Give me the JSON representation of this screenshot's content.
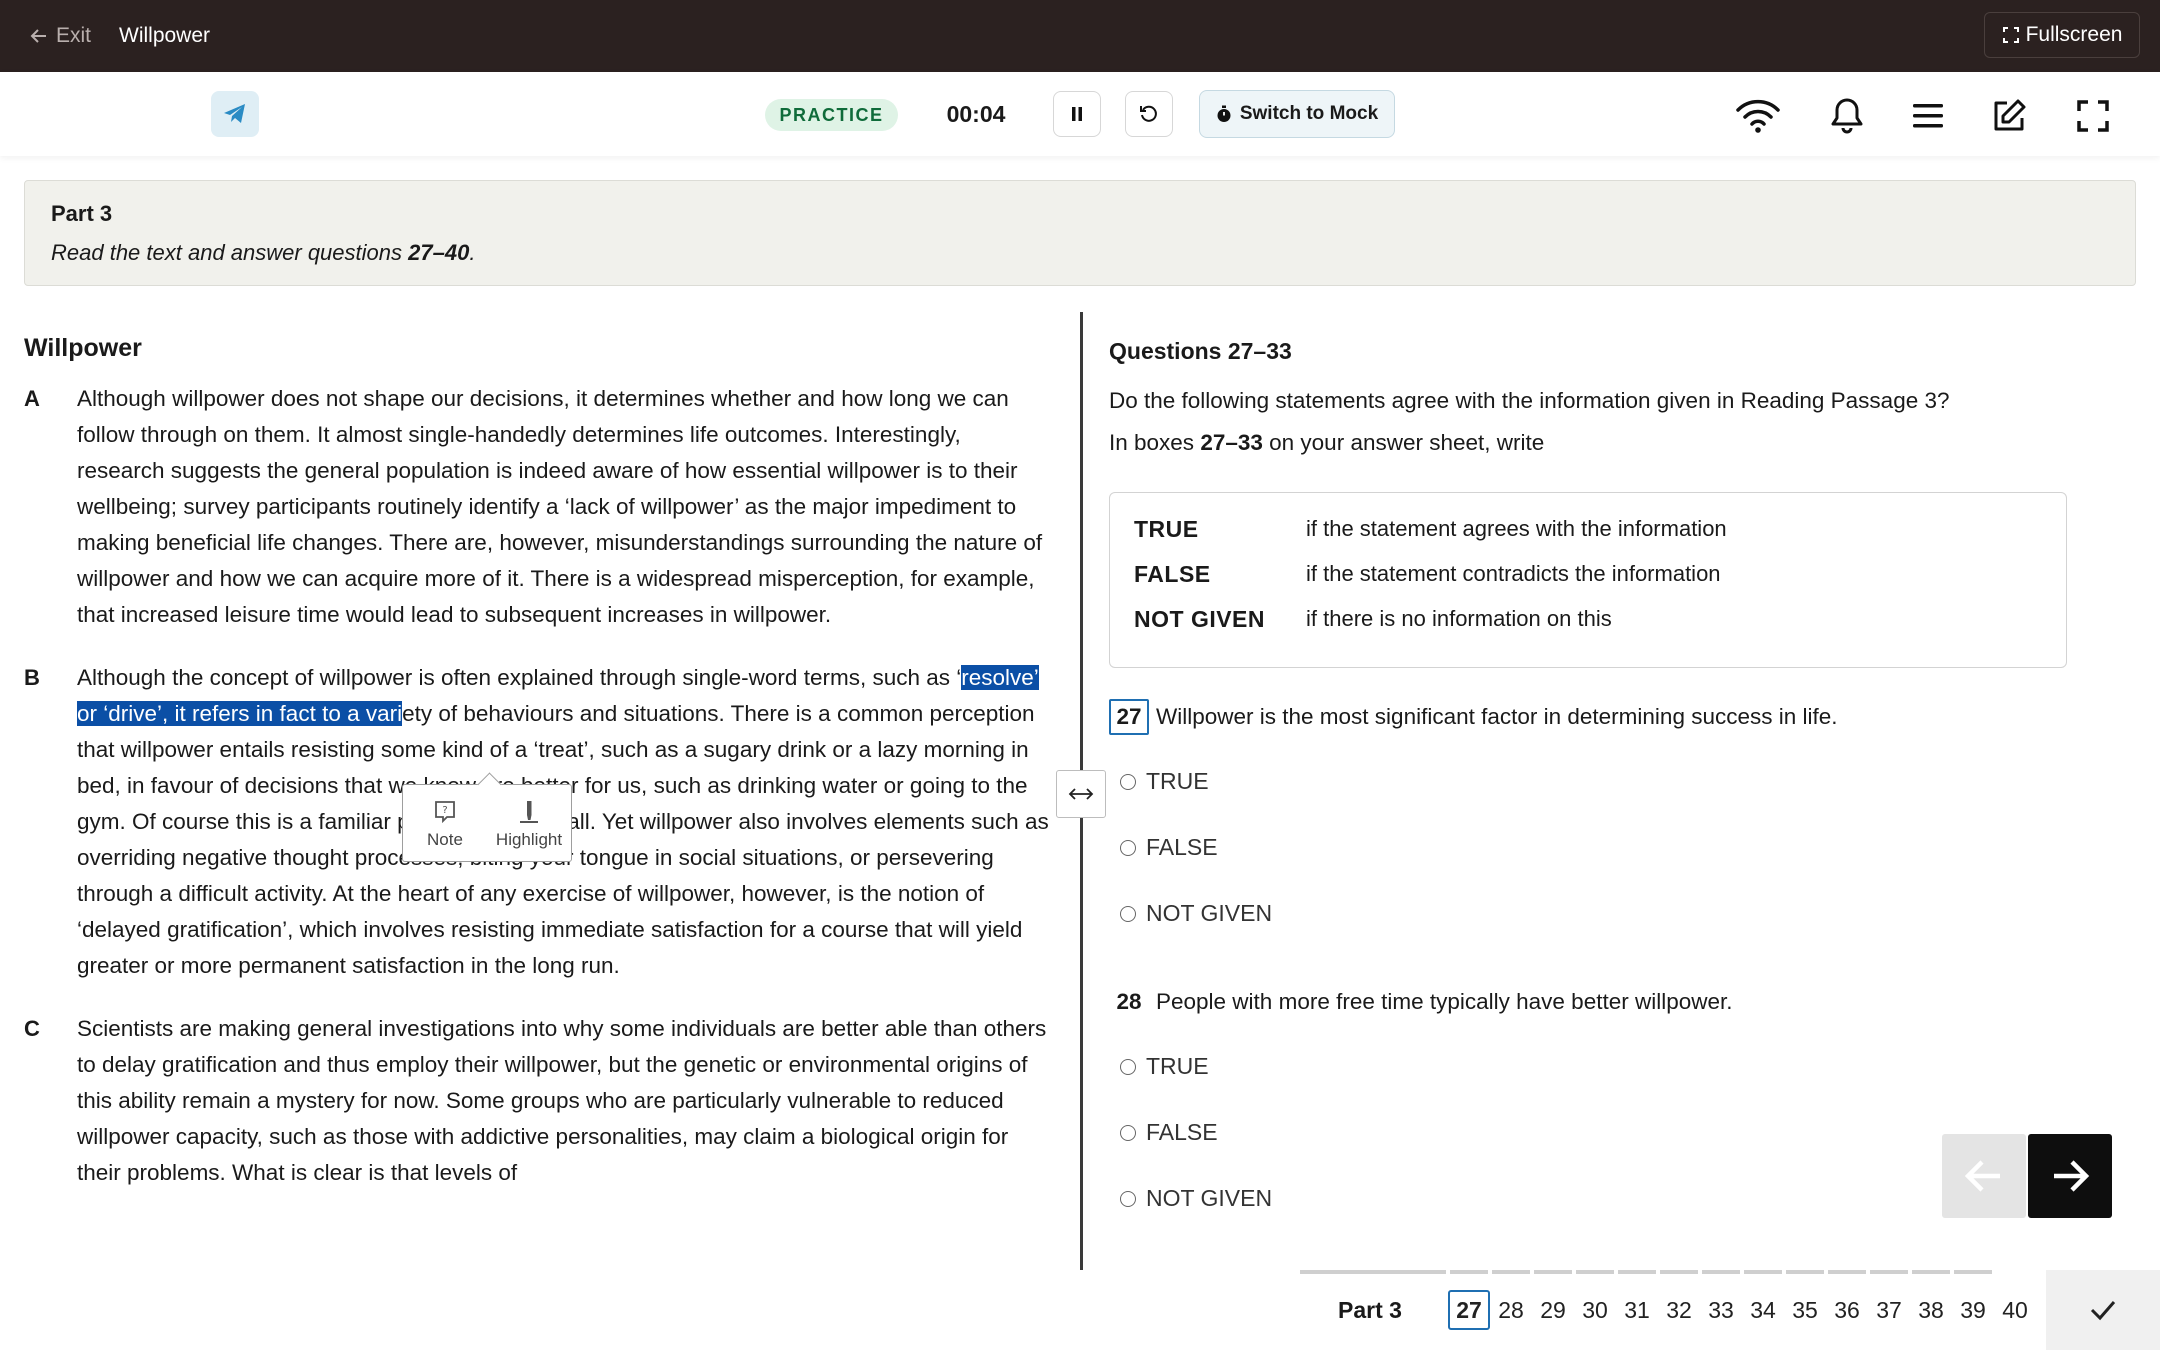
{
  "topbar": {
    "exit_label": "Exit",
    "title": "Willpower",
    "fullscreen_label": "Fullscreen"
  },
  "toolbar": {
    "mode": "PRACTICE",
    "timer": "00:04",
    "switch_label": "Switch to Mock"
  },
  "part": {
    "title": "Part 3",
    "instruction_pre": "Read the text and answer questions ",
    "instruction_range": "27–40",
    "instruction_post": "."
  },
  "passage": {
    "title": "Willpower",
    "paragraphs": [
      {
        "letter": "A",
        "text": "Although willpower does not shape our decisions, it determines whether and how long we can follow through on them. It almost single-handedly determines life outcomes. Interestingly, research suggests the general population is indeed aware of how essential willpower is to their wellbeing; survey participants routinely identify a ‘lack of willpower’ as the major impediment to making beneficial life changes. There are, however, misunderstandings surrounding the nature of willpower and how we can acquire more of it. There is a widespread misperception, for example, that increased leisure time would lead to subsequent increases in willpower."
      },
      {
        "letter": "B",
        "text_pre": "Although the concept of willpower is often explained through single-word terms, such as ‘",
        "text_highlight": "resolve’ or ‘drive’, it refers in fact to a vari",
        "text_post": "ety of behaviours and situations. There is a common perception that willpower entails resisting some kind of a ‘treat’, such as a sugary drink or a lazy morning in bed, in favour of decisions that we know are better for us, such as drinking water or going to the gym. Of course this is a familiar phenomenon for all. Yet willpower also involves elements such as overriding negative thought processes, biting your tongue in social situations, or persevering through a difficult activity. At the heart of any exercise of willpower, however, is the notion of ‘delayed gratification’, which involves resisting immediate satisfaction for a course that will yield greater or more permanent satisfaction in the long run."
      },
      {
        "letter": "C",
        "text": "Scientists are making general investigations into why some individuals are better able than others to delay gratification and thus employ their willpower, but the genetic or environmental origins of this ability remain a mystery for now. Some groups who are particularly vulnerable to reduced willpower capacity, such as those with addictive personalities, may claim a biological origin for their problems. What is clear is that levels of"
      }
    ]
  },
  "popup": {
    "note_label": "Note",
    "highlight_label": "Highlight"
  },
  "questions": {
    "heading": "Questions 27–33",
    "line1": "Do the following statements agree with the information given in Reading Passage 3?",
    "line2_pre": "In boxes ",
    "line2_range": "27–33",
    "line2_post": " on your answer sheet, write",
    "key": [
      {
        "term": "TRUE",
        "def": "if the statement agrees with the information"
      },
      {
        "term": "FALSE",
        "def": "if the statement contradicts the information"
      },
      {
        "term": "NOT GIVEN",
        "def": "if there is no information on this"
      }
    ],
    "items": [
      {
        "num": "27",
        "text": "Willpower is the most significant factor in determining success in life.",
        "options": [
          "TRUE",
          "FALSE",
          "NOT GIVEN"
        ]
      },
      {
        "num": "28",
        "text": "People with more free time typically have better willpower.",
        "options": [
          "TRUE",
          "FALSE",
          "NOT GIVEN"
        ]
      }
    ]
  },
  "bottom": {
    "part_label": "Part 3",
    "numbers": [
      "27",
      "28",
      "29",
      "30",
      "31",
      "32",
      "33",
      "34",
      "35",
      "36",
      "37",
      "38",
      "39",
      "40"
    ],
    "active": "27"
  },
  "colors": {
    "topbar": "#2b2120",
    "accent": "#1f6fb2",
    "highlight": "#0b4fa6",
    "practice_bg": "#dff3e6",
    "practice_text": "#0f6b3a"
  },
  "icons": [
    "arrow-left-icon",
    "expand-icon",
    "telegram-icon",
    "pause-icon",
    "reset-icon",
    "stopwatch-icon",
    "wifi-icon",
    "bell-icon",
    "menu-icon",
    "edit-icon",
    "fullscreen-icon",
    "resize-icon",
    "note-icon",
    "highlight-icon",
    "arrow-right-icon",
    "check-icon"
  ]
}
